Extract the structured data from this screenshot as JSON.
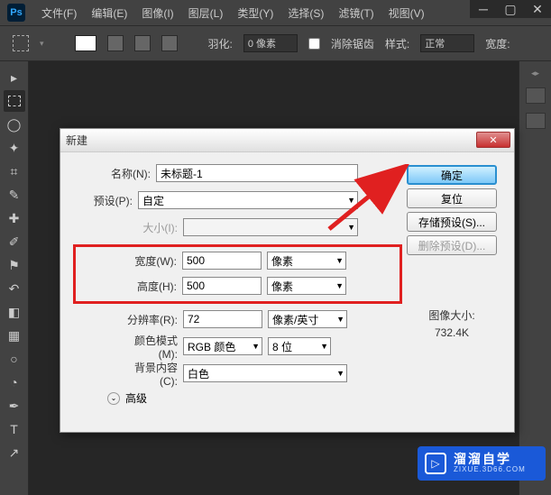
{
  "menubar": {
    "items": [
      "文件(F)",
      "编辑(E)",
      "图像(I)",
      "图层(L)",
      "类型(Y)",
      "选择(S)",
      "滤镜(T)",
      "视图(V)"
    ]
  },
  "optionsbar": {
    "feather_label": "羽化:",
    "feather_value": "0 像素",
    "antialias": "消除锯齿",
    "style_label": "样式:",
    "style_value": "正常",
    "width_label": "宽度:"
  },
  "dialog": {
    "title": "新建",
    "labels": {
      "name": "名称(N):",
      "preset": "预设(P):",
      "size": "大小(I):",
      "width": "宽度(W):",
      "height": "高度(H):",
      "resolution": "分辨率(R):",
      "color_mode": "颜色模式(M):",
      "bg_content": "背景内容(C):",
      "advanced": "高级"
    },
    "values": {
      "name": "未标题-1",
      "preset": "自定",
      "size": "",
      "width": "500",
      "height": "500",
      "resolution": "72",
      "color_mode": "RGB 颜色",
      "color_depth": "8 位",
      "bg_content": "白色"
    },
    "units": {
      "width": "像素",
      "height": "像素",
      "resolution": "像素/英寸"
    },
    "buttons": {
      "ok": "确定",
      "reset": "复位",
      "save_preset": "存储预设(S)...",
      "delete_preset": "删除预设(D)..."
    },
    "info": {
      "size_label": "图像大小:",
      "size_value": "732.4K"
    }
  },
  "watermark": {
    "brand": "溜溜自学",
    "url": "ZIXUE.3D66.COM"
  }
}
